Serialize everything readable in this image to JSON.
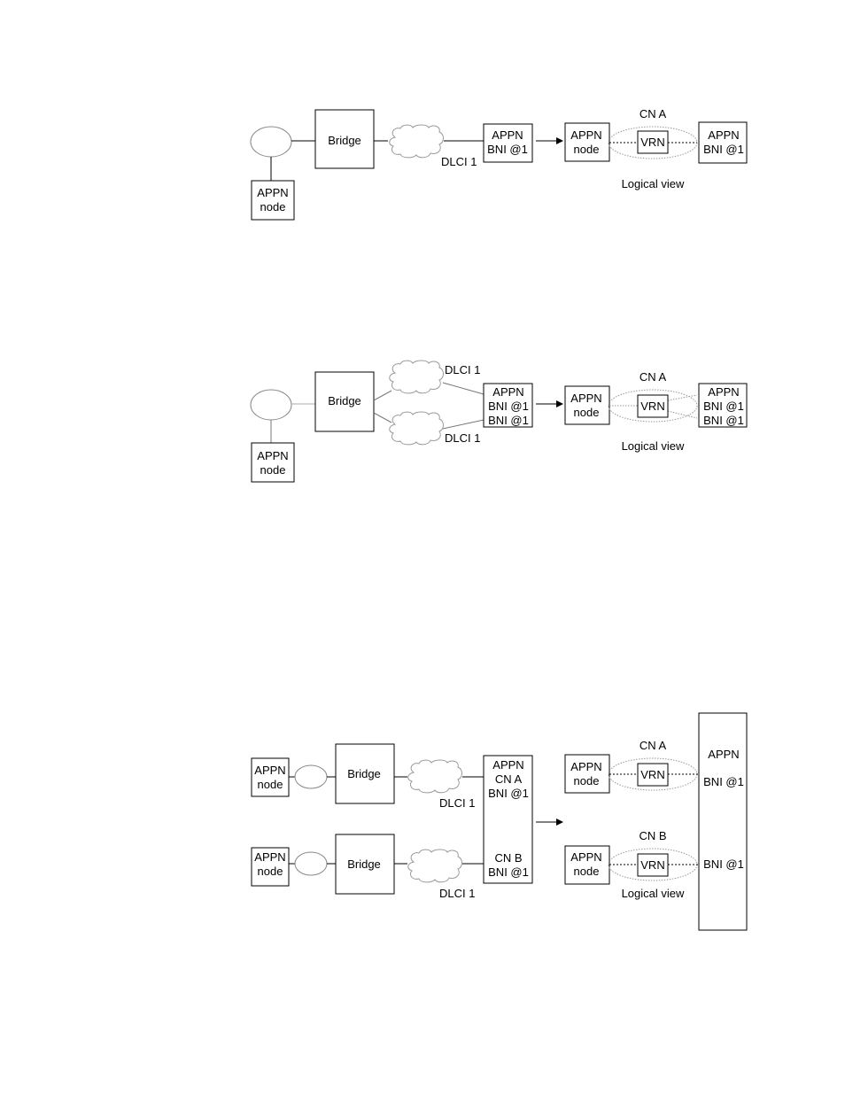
{
  "figures": [
    {
      "id": "figure-1",
      "physical": {
        "lan_node": "APPN node",
        "lan_node_lines": [
          "APPN",
          "node"
        ],
        "bridge": "Bridge",
        "dlci_labels": [
          "DLCI 1"
        ],
        "bni_node_lines": [
          "APPN",
          "BNI @1"
        ]
      },
      "logical": {
        "cn_label": "CN A",
        "appn_node_lines": [
          "APPN",
          "node"
        ],
        "vrn": "VRN",
        "bni_node_lines": [
          "APPN",
          "BNI @1"
        ],
        "caption": "Logical view"
      }
    },
    {
      "id": "figure-2",
      "physical": {
        "lan_node_lines": [
          "APPN",
          "node"
        ],
        "bridge": "Bridge",
        "dlci_labels": [
          "DLCI 1",
          "DLCI 1"
        ],
        "bni_node_lines": [
          "APPN",
          "BNI @1",
          "BNI @1"
        ]
      },
      "logical": {
        "cn_label": "CN A",
        "appn_node_lines": [
          "APPN",
          "node"
        ],
        "vrn": "VRN",
        "bni_node_lines": [
          "APPN",
          "BNI @1",
          "BNI @1"
        ],
        "caption": "Logical view"
      }
    },
    {
      "id": "figure-3",
      "physical": {
        "lan_nodes": [
          [
            "APPN",
            "node"
          ],
          [
            "APPN",
            "node"
          ]
        ],
        "bridges": [
          "Bridge",
          "Bridge"
        ],
        "dlci_labels": [
          "DLCI 1",
          "DLCI 1"
        ],
        "bni_node_lines_top": [
          "APPN",
          "CN A",
          "BNI @1"
        ],
        "bni_node_lines_bottom": [
          "CN B",
          "BNI @1"
        ]
      },
      "logical": {
        "cn_labels": [
          "CN A",
          "CN B"
        ],
        "appn_nodes": [
          [
            "APPN",
            "node"
          ],
          [
            "APPN",
            "node"
          ]
        ],
        "vrns": [
          "VRN",
          "VRN"
        ],
        "bni_node_lines": [
          "APPN",
          "BNI @1",
          "BNI @1"
        ],
        "caption": "Logical view"
      }
    }
  ]
}
